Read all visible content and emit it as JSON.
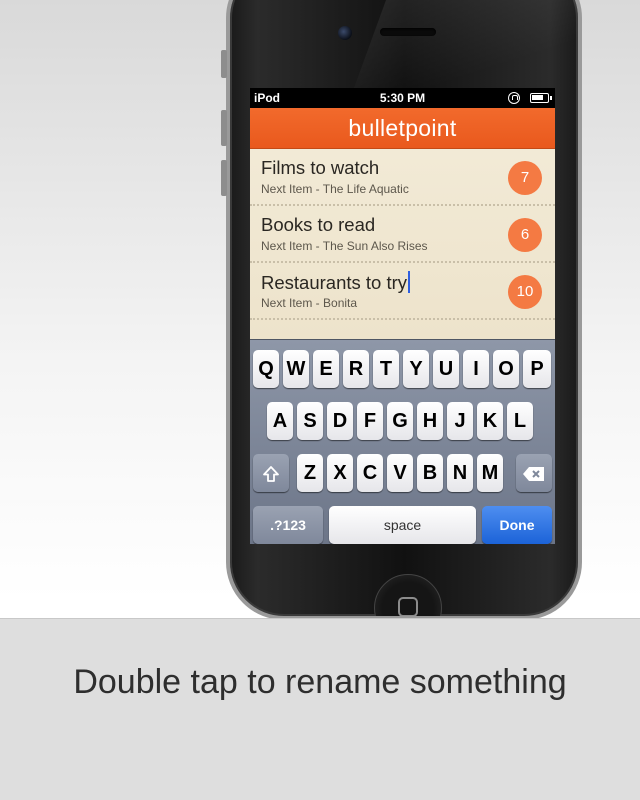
{
  "status_bar": {
    "carrier": "iPod",
    "time": "5:30 PM"
  },
  "app": {
    "title": "bulletpoint",
    "accent_color": "#f26a2c"
  },
  "lists": [
    {
      "title": "Films to watch",
      "subtitle": "Next Item - The Life Aquatic",
      "count": "7"
    },
    {
      "title": "Books to read",
      "subtitle": "Next Item - The Sun Also Rises",
      "count": "6"
    },
    {
      "title": "Restaurants to try",
      "subtitle": "Next Item - Bonita",
      "count": "10"
    }
  ],
  "keyboard": {
    "row1": [
      "Q",
      "W",
      "E",
      "R",
      "T",
      "Y",
      "U",
      "I",
      "O",
      "P"
    ],
    "row2": [
      "A",
      "S",
      "D",
      "F",
      "G",
      "H",
      "J",
      "K",
      "L"
    ],
    "row3": [
      "Z",
      "X",
      "C",
      "V",
      "B",
      "N",
      "M"
    ],
    "shift_icon": "shift-icon",
    "delete_icon": "delete-icon",
    "numbers_label": ".?123",
    "space_label": "space",
    "done_label": "Done"
  },
  "caption": "Double tap to rename something"
}
